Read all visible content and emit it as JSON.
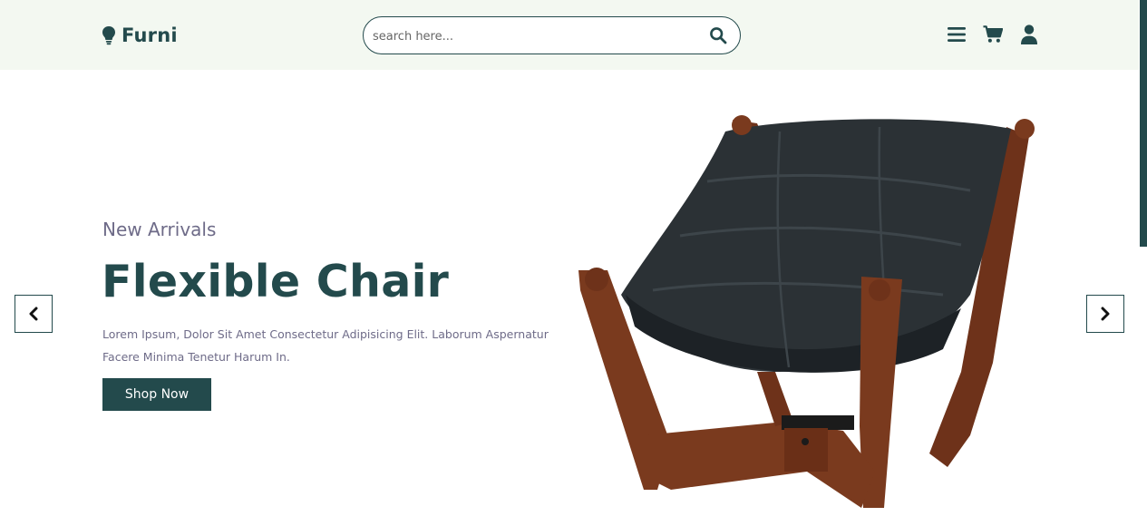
{
  "header": {
    "logo_text": "Furni",
    "logo_icon": "lightbulb-icon",
    "search": {
      "placeholder": "search here...",
      "value": ""
    },
    "icons": [
      "menu-icon",
      "cart-icon",
      "user-icon"
    ]
  },
  "hero": {
    "eyebrow": "New Arrivals",
    "title": "Flexible Chair",
    "description": "Lorem Ipsum, Dolor Sit Amet Consectetur Adipisicing Elit. Laborum Aspernatur Facere Minima Tenetur Harum In.",
    "button_label": "Shop Now"
  },
  "slider": {
    "prev_icon": "chevron-left-icon",
    "next_icon": "chevron-right-icon"
  },
  "colors": {
    "brand": "#234a4c",
    "header_bg": "#f3f8f1",
    "muted_text": "#6e6b88",
    "wood": "#7a3a1e",
    "leather": "#2b3135"
  }
}
